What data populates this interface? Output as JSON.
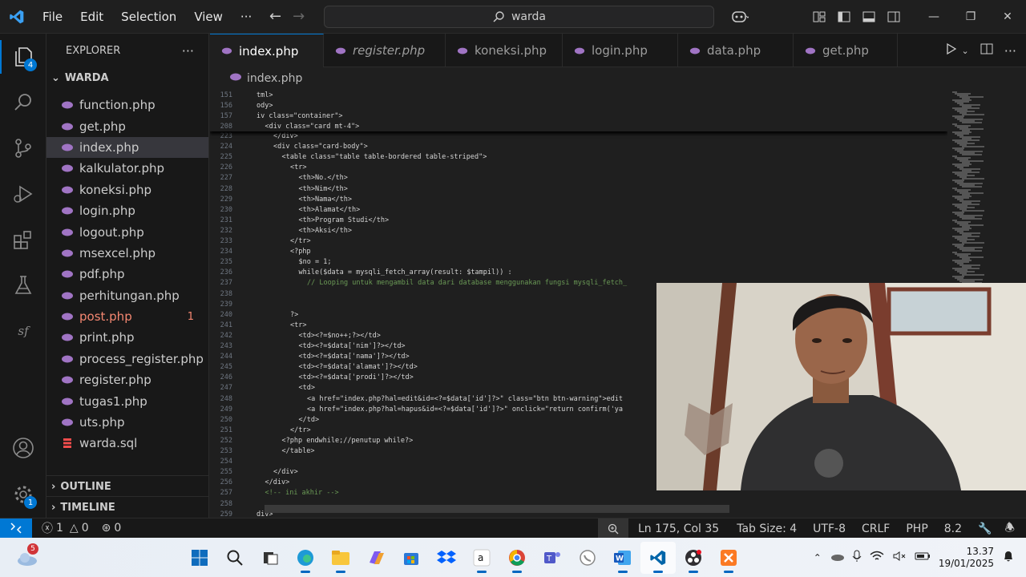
{
  "titlebar": {
    "menu": [
      "File",
      "Edit",
      "Selection",
      "View"
    ],
    "more": "···",
    "search_text": "warda"
  },
  "activity": {
    "explorer_badge": "4",
    "settings_badge": "1"
  },
  "sidebar": {
    "title": "EXPLORER",
    "more": "···",
    "folder": "WARDA",
    "files": [
      {
        "name": "function.php",
        "type": "php"
      },
      {
        "name": "get.php",
        "type": "php"
      },
      {
        "name": "index.php",
        "type": "php",
        "selected": true
      },
      {
        "name": "kalkulator.php",
        "type": "php"
      },
      {
        "name": "koneksi.php",
        "type": "php"
      },
      {
        "name": "login.php",
        "type": "php"
      },
      {
        "name": "logout.php",
        "type": "php"
      },
      {
        "name": "msexcel.php",
        "type": "php"
      },
      {
        "name": "pdf.php",
        "type": "php"
      },
      {
        "name": "perhitungan.php",
        "type": "php"
      },
      {
        "name": "post.php",
        "type": "php",
        "error": true,
        "count": "1"
      },
      {
        "name": "print.php",
        "type": "php"
      },
      {
        "name": "process_register.php",
        "type": "php"
      },
      {
        "name": "register.php",
        "type": "php"
      },
      {
        "name": "tugas1.php",
        "type": "php"
      },
      {
        "name": "uts.php",
        "type": "php"
      },
      {
        "name": "warda.sql",
        "type": "sql"
      }
    ],
    "outline": "OUTLINE",
    "timeline": "TIMELINE"
  },
  "tabs": [
    {
      "label": "index.php",
      "active": true,
      "dirty": true
    },
    {
      "label": "register.php",
      "italic": true
    },
    {
      "label": "koneksi.php",
      "dirty": true
    },
    {
      "label": "login.php",
      "dirty": true
    },
    {
      "label": "data.php"
    },
    {
      "label": "get.php"
    }
  ],
  "breadcrumb": "index.php",
  "code": {
    "sticky": [
      {
        "n": "151",
        "t": "tml>",
        "indent": 0
      },
      {
        "n": "156",
        "t": "ody>",
        "indent": 0
      },
      {
        "n": "157",
        "t": "iv class=\"container\">",
        "indent": 0
      },
      {
        "n": "208",
        "t": "<div class=\"card mt-4\">",
        "indent": 1
      }
    ],
    "lines": [
      {
        "n": "223",
        "t": "</div>",
        "indent": 2
      },
      {
        "n": "224",
        "t": "<div class=\"card-body\">",
        "indent": 2
      },
      {
        "n": "225",
        "t": "<table class=\"table table-bordered table-striped\">",
        "indent": 3
      },
      {
        "n": "226",
        "t": "<tr>",
        "indent": 4
      },
      {
        "n": "227",
        "t": "<th>No.</th>",
        "indent": 5
      },
      {
        "n": "228",
        "t": "<th>Nim</th>",
        "indent": 5
      },
      {
        "n": "229",
        "t": "<th>Nama</th>",
        "indent": 5
      },
      {
        "n": "230",
        "t": "<th>Alamat</th>",
        "indent": 5
      },
      {
        "n": "231",
        "t": "<th>Program Studi</th>",
        "indent": 5
      },
      {
        "n": "232",
        "t": "<th>Aksi</th>",
        "indent": 5
      },
      {
        "n": "233",
        "t": "</tr>",
        "indent": 4
      },
      {
        "n": "234",
        "t": "<?php",
        "indent": 4
      },
      {
        "n": "235",
        "t": "$no = 1;",
        "indent": 5
      },
      {
        "n": "236",
        "t": "while($data = mysqli_fetch_array(result: $tampil)) :",
        "indent": 5
      },
      {
        "n": "237",
        "t": "// Looping untuk mengambil data dari database menggunakan fungsi mysqli_fetch_",
        "indent": 6,
        "comment": true
      },
      {
        "n": "238",
        "t": "",
        "indent": 0
      },
      {
        "n": "239",
        "t": "",
        "indent": 0
      },
      {
        "n": "240",
        "t": "?>",
        "indent": 4
      },
      {
        "n": "241",
        "t": "<tr>",
        "indent": 4
      },
      {
        "n": "242",
        "t": "<td><?=$no++;?></td>",
        "indent": 5
      },
      {
        "n": "243",
        "t": "<td><?=$data['nim']?></td>",
        "indent": 5
      },
      {
        "n": "244",
        "t": "<td><?=$data['nama']?></td>",
        "indent": 5
      },
      {
        "n": "245",
        "t": "<td><?=$data['alamat']?></td>",
        "indent": 5
      },
      {
        "n": "246",
        "t": "<td><?=$data['prodi']?></td>",
        "indent": 5
      },
      {
        "n": "247",
        "t": "<td>",
        "indent": 5
      },
      {
        "n": "248",
        "t": "<a href=\"index.php?hal=edit&id=<?=$data['id']?>\" class=\"btn btn-warning\">edit",
        "indent": 6
      },
      {
        "n": "249",
        "t": "<a href=\"index.php?hal=hapus&id=<?=$data['id']?>\" onclick=\"return confirm('ya",
        "indent": 6
      },
      {
        "n": "250",
        "t": "</td>",
        "indent": 5
      },
      {
        "n": "251",
        "t": "</tr>",
        "indent": 4
      },
      {
        "n": "252",
        "t": "<?php endwhile;//penutup while?>",
        "indent": 3
      },
      {
        "n": "253",
        "t": "</table>",
        "indent": 3
      },
      {
        "n": "254",
        "t": "",
        "indent": 0
      },
      {
        "n": "255",
        "t": "</div>",
        "indent": 2
      },
      {
        "n": "256",
        "t": "</div>",
        "indent": 1
      },
      {
        "n": "257",
        "t": "<!-- ini akhir -->",
        "indent": 1,
        "comment": true
      },
      {
        "n": "258",
        "t": "",
        "indent": 0
      },
      {
        "n": "259",
        "t": "div>",
        "indent": 0
      }
    ]
  },
  "status": {
    "errors": "1",
    "warnings": "0",
    "ports": "0",
    "position": "Ln 175, Col 35",
    "tab_size": "Tab Size: 4",
    "encoding": "UTF-8",
    "eol": "CRLF",
    "language": "PHP",
    "version": "8.2"
  },
  "taskbar": {
    "weather_badge": "5",
    "time": "13.37",
    "date": "19/01/2025"
  },
  "colors": {
    "accent": "#0078d4",
    "php_icon": "#a074c4",
    "sql_icon": "#f14c4c",
    "error": "#f48771"
  }
}
